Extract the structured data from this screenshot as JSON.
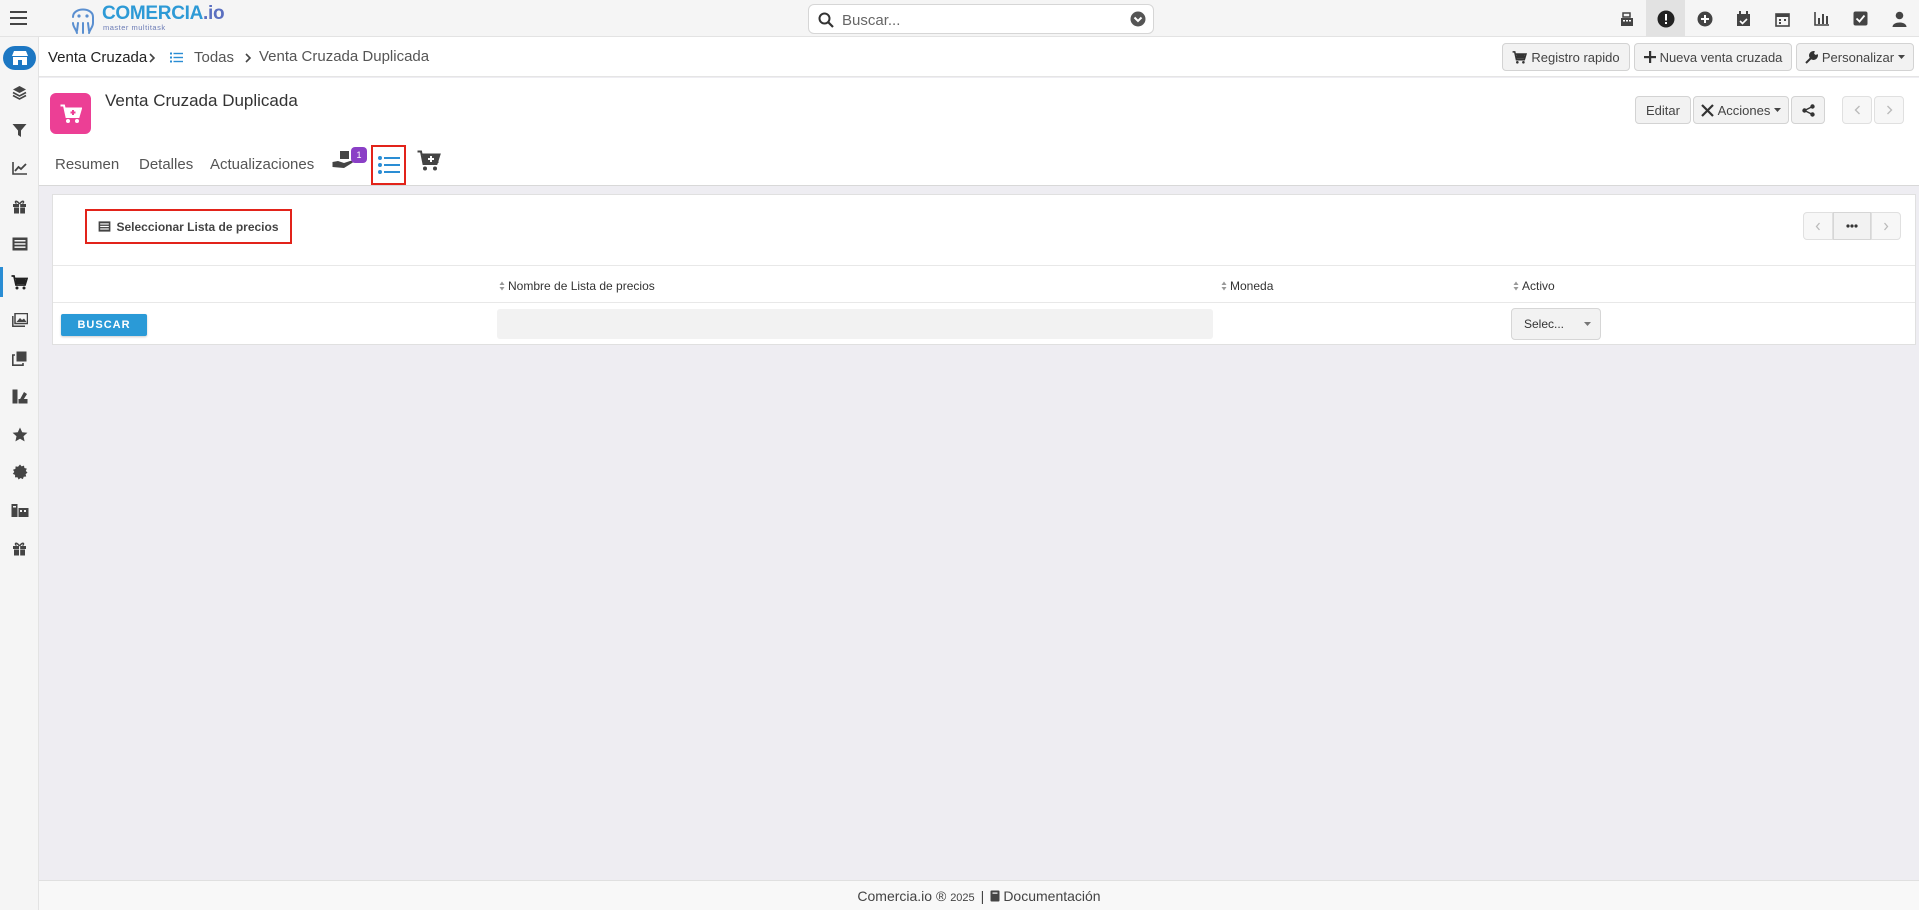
{
  "app": {
    "name": "COMERCIA",
    "name_suffix": ".io",
    "tagline": "master multitask",
    "brand_color": "#2d9ad6"
  },
  "search": {
    "placeholder": "Buscar..."
  },
  "topbar_icons": [
    "cash-register-icon",
    "alert-icon",
    "plus-circle-icon",
    "calendar-check-icon",
    "calendar-icon",
    "bar-chart-icon",
    "checkbox-icon",
    "user-icon"
  ],
  "sidebar_icons": [
    "home-store-icon",
    "layers-icon",
    "filter-icon",
    "chart-line-icon",
    "gift-icon",
    "list-alt-icon",
    "cart-icon",
    "images-icon",
    "clone-icon",
    "swatch-icon",
    "star-icon",
    "certificate-icon",
    "boxes-icon",
    "gift-icon"
  ],
  "breadcrumb": {
    "module": "Venta Cruzada",
    "list": "Todas",
    "current": "Venta Cruzada Duplicada"
  },
  "toolbar": {
    "quick_register": "Registro rapido",
    "new": "Nueva venta cruzada",
    "customize": "Personalizar"
  },
  "record": {
    "title": "Venta Cruzada Duplicada",
    "accent_color": "#ec3f95"
  },
  "record_actions": {
    "edit": "Editar",
    "actions": "Acciones"
  },
  "tabs": {
    "summary": "Resumen",
    "details": "Detalles",
    "updates": "Actualizaciones",
    "badge_count": "1"
  },
  "panel": {
    "select_label": "Seleccionar Lista de precios",
    "columns": {
      "name": "Nombre de Lista de precios",
      "currency": "Moneda",
      "active": "Activo"
    },
    "search_button": "BUSCAR",
    "active_select": "Selec..."
  },
  "footer": {
    "brand": "Comercia.io ®",
    "year": "2025",
    "separator": "|",
    "docs": "Documentación"
  }
}
